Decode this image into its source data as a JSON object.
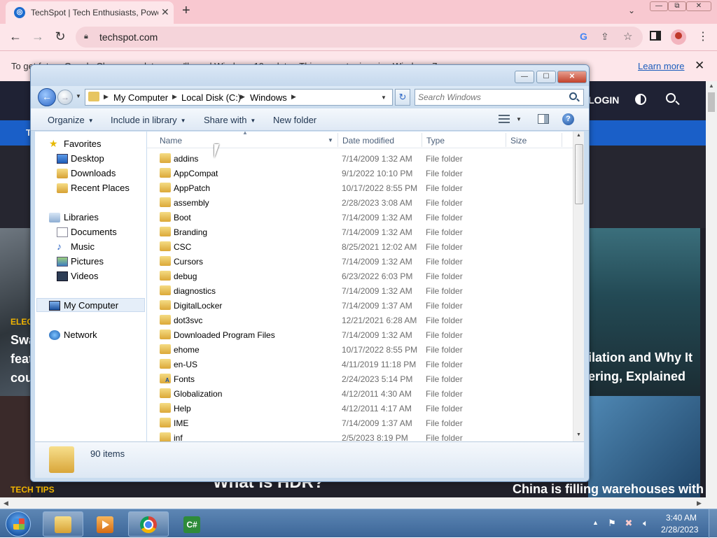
{
  "browser": {
    "tab_title": "TechSpot | Tech Enthusiasts, Power",
    "tab_close": "✕",
    "new_tab": "+",
    "tab_search": "⌄",
    "window_min": "—",
    "window_max": "⧉",
    "window_close": "✕",
    "back": "←",
    "forward": "→",
    "reload": "↻",
    "url": "techspot.com",
    "menu": "⋮"
  },
  "infobar": {
    "message": "To get future Google Chrome updates, you'll need Windows 10 or later. This computer is using Windows 7.",
    "learn_more": "Learn more",
    "close": "✕"
  },
  "site": {
    "login": "LOGIN",
    "nav_label": "T",
    "left_category": "ELEC",
    "left_lines": [
      "Swa",
      "feat",
      "cou"
    ],
    "right_lines": [
      "ilation and Why It",
      "ering, Explained"
    ],
    "tech_tips": "TECH TIPS",
    "hdr_headline": "What is HDR?",
    "china_headline": "China is filling warehouses with"
  },
  "explorer": {
    "controls": {
      "minimize": "—",
      "maximize": "☐",
      "close": "✕"
    },
    "back": "←",
    "forward": "→",
    "breadcrumbs": [
      "My Computer",
      "Local Disk (C:)",
      "Windows"
    ],
    "search_placeholder": "Search Windows",
    "commands": {
      "organize": "Organize",
      "include_in_library": "Include in library",
      "share_with": "Share with",
      "new_folder": "New folder"
    },
    "nav": {
      "favorites": "Favorites",
      "desktop": "Desktop",
      "downloads": "Downloads",
      "recent_places": "Recent Places",
      "libraries": "Libraries",
      "documents": "Documents",
      "music": "Music",
      "pictures": "Pictures",
      "videos": "Videos",
      "my_computer": "My Computer",
      "network": "Network"
    },
    "columns": {
      "name": "Name",
      "date": "Date modified",
      "type": "Type",
      "size": "Size"
    },
    "files": [
      {
        "name": "addins",
        "date": "7/14/2009 1:32 AM",
        "type": "File folder"
      },
      {
        "name": "AppCompat",
        "date": "9/1/2022 10:10 PM",
        "type": "File folder"
      },
      {
        "name": "AppPatch",
        "date": "10/17/2022 8:55 PM",
        "type": "File folder"
      },
      {
        "name": "assembly",
        "date": "2/28/2023 3:08 AM",
        "type": "File folder"
      },
      {
        "name": "Boot",
        "date": "7/14/2009 1:32 AM",
        "type": "File folder"
      },
      {
        "name": "Branding",
        "date": "7/14/2009 1:32 AM",
        "type": "File folder"
      },
      {
        "name": "CSC",
        "date": "8/25/2021 12:02 AM",
        "type": "File folder"
      },
      {
        "name": "Cursors",
        "date": "7/14/2009 1:32 AM",
        "type": "File folder"
      },
      {
        "name": "debug",
        "date": "6/23/2022 6:03 PM",
        "type": "File folder"
      },
      {
        "name": "diagnostics",
        "date": "7/14/2009 1:32 AM",
        "type": "File folder"
      },
      {
        "name": "DigitalLocker",
        "date": "7/14/2009 1:37 AM",
        "type": "File folder"
      },
      {
        "name": "dot3svc",
        "date": "12/21/2021 6:28 AM",
        "type": "File folder"
      },
      {
        "name": "Downloaded Program Files",
        "date": "7/14/2009 1:32 AM",
        "type": "File folder"
      },
      {
        "name": "ehome",
        "date": "10/17/2022 8:55 PM",
        "type": "File folder"
      },
      {
        "name": "en-US",
        "date": "4/11/2019 11:18 PM",
        "type": "File folder"
      },
      {
        "name": "Fonts",
        "date": "2/24/2023 5:14 PM",
        "type": "File folder"
      },
      {
        "name": "Globalization",
        "date": "4/12/2011 4:30 AM",
        "type": "File folder"
      },
      {
        "name": "Help",
        "date": "4/12/2011 4:17 AM",
        "type": "File folder"
      },
      {
        "name": "IME",
        "date": "7/14/2009 1:37 AM",
        "type": "File folder"
      },
      {
        "name": "inf",
        "date": "2/5/2023 8:19 PM",
        "type": "File folder"
      }
    ],
    "item_count": "90 items"
  },
  "taskbar": {
    "csharp_label": "C#",
    "time": "3:40 AM",
    "date": "2/28/2023"
  },
  "colors": {
    "chrome_tabbar": "#f8c8d0",
    "site_nav_blue": "#1a5fc8",
    "explorer_frame": "#c9dcef",
    "taskbar": "#3c6698"
  }
}
